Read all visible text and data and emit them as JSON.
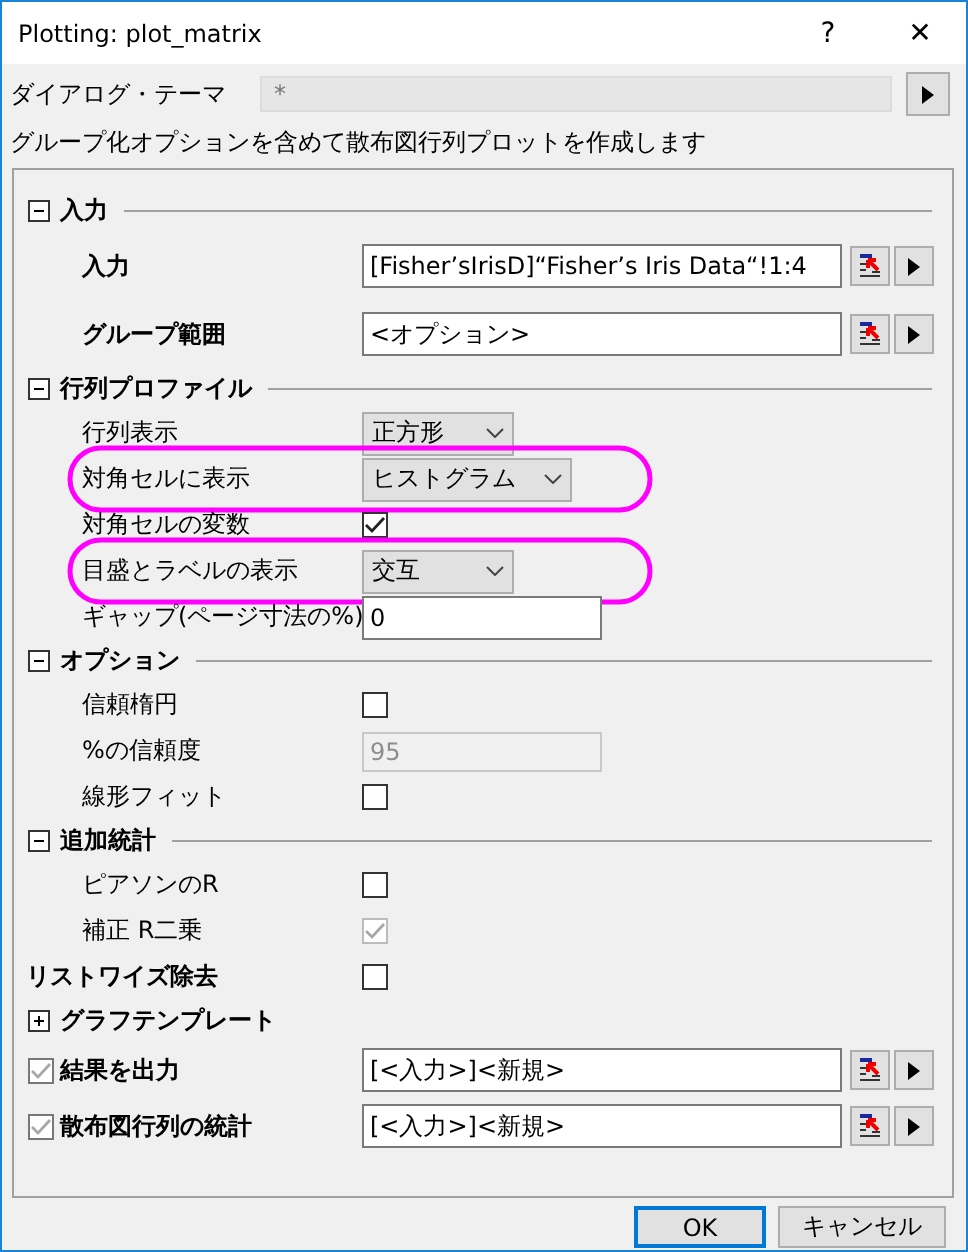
{
  "window": {
    "title": "Plotting: plot_matrix",
    "help": "?",
    "close": "✕"
  },
  "theme": {
    "label": "ダイアログ・テーマ",
    "value": "*"
  },
  "description": "グループ化オプションを含めて散布図行列プロットを作成します",
  "tree": [
    {
      "kind": "section",
      "label": "入力",
      "expanded": true,
      "children": [
        {
          "kind": "range",
          "label": "入力",
          "bold": true,
          "value": "[Fisher’sIrisD]“Fisher’s Iris Data“!1:4"
        },
        {
          "kind": "range",
          "label": "グループ範囲",
          "bold": true,
          "value": "<オプション>"
        }
      ]
    },
    {
      "kind": "section",
      "label": "行列プロファイル",
      "expanded": true,
      "children": [
        {
          "kind": "dropdown",
          "label": "行列表示",
          "value": "正方形",
          "highlighted": false
        },
        {
          "kind": "dropdown",
          "label": "対角セルに表示",
          "value": "ヒストグラム",
          "highlighted": true
        },
        {
          "kind": "checkbox",
          "label": "対角セルの変数",
          "checked": true,
          "disabled": false
        },
        {
          "kind": "dropdown",
          "label": "目盛とラベルの表示",
          "value": "交互",
          "highlighted": true
        },
        {
          "kind": "text",
          "label": "ギャップ(ページ寸法の%)",
          "value": "0",
          "disabled": false
        }
      ]
    },
    {
      "kind": "section",
      "label": "オプション",
      "expanded": true,
      "children": [
        {
          "kind": "checkbox",
          "label": "信頼楕円",
          "checked": false,
          "disabled": false
        },
        {
          "kind": "text",
          "label": "%の信頼度",
          "value": "95",
          "disabled": true
        },
        {
          "kind": "checkbox",
          "label": "線形フィット",
          "checked": false,
          "disabled": false
        }
      ]
    },
    {
      "kind": "section",
      "label": "追加統計",
      "expanded": true,
      "children": [
        {
          "kind": "checkbox",
          "label": "ピアソンのR",
          "checked": false,
          "disabled": false
        },
        {
          "kind": "checkbox",
          "label": "補正 R二乗",
          "checked": true,
          "disabled": true
        }
      ]
    },
    {
      "kind": "checkbox",
      "label": "リストワイズ除去",
      "bold": true,
      "checked": false,
      "disabled": false
    },
    {
      "kind": "section",
      "label": "グラフテンプレート",
      "expanded": false
    },
    {
      "kind": "checkrange",
      "label": "結果を出力",
      "bold": true,
      "checked": true,
      "value": "[<入力>]<新規>"
    },
    {
      "kind": "checkrange",
      "label": "散布図行列の統計",
      "bold": true,
      "checked": true,
      "value": "[<入力>]<新規>"
    }
  ],
  "buttons": [
    {
      "label": "OK",
      "default": true
    },
    {
      "label": "キャンセル",
      "default": false
    }
  ]
}
